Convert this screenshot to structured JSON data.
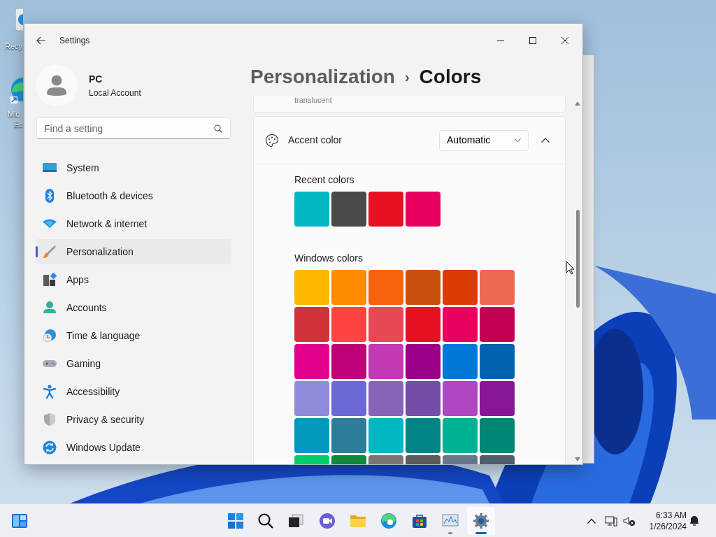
{
  "desktop_icons": [
    {
      "lines": [
        "Recy"
      ]
    },
    {
      "lines": [
        "Mic",
        "Ec"
      ]
    }
  ],
  "window": {
    "title": "Settings"
  },
  "profile": {
    "name": "PC",
    "account_type": "Local Account"
  },
  "search": {
    "placeholder": "Find a setting"
  },
  "nav": {
    "items": [
      {
        "label": "System",
        "selected": false
      },
      {
        "label": "Bluetooth & devices",
        "selected": false
      },
      {
        "label": "Network & internet",
        "selected": false
      },
      {
        "label": "Personalization",
        "selected": true
      },
      {
        "label": "Apps",
        "selected": false
      },
      {
        "label": "Accounts",
        "selected": false
      },
      {
        "label": "Time & language",
        "selected": false
      },
      {
        "label": "Gaming",
        "selected": false
      },
      {
        "label": "Accessibility",
        "selected": false
      },
      {
        "label": "Privacy & security",
        "selected": false
      },
      {
        "label": "Windows Update",
        "selected": false
      }
    ]
  },
  "breadcrumb": {
    "parent": "Personalization",
    "separator": "›",
    "current": "Colors"
  },
  "partial_card": {
    "text": "translucent"
  },
  "accent": {
    "label": "Accent color",
    "dropdown": "Automatic",
    "expanded": true,
    "recent": {
      "label": "Recent colors",
      "colors": [
        {
          "color": "#00b7c3"
        },
        {
          "color": "#4c4a48"
        },
        {
          "color": "#e81123"
        },
        {
          "color": "#ea005e"
        }
      ]
    },
    "windows": {
      "label": "Windows colors",
      "colors": [
        {
          "color": "#ffb900"
        },
        {
          "color": "#ff8c00"
        },
        {
          "color": "#f7630c"
        },
        {
          "color": "#ca5010"
        },
        {
          "color": "#da3b01"
        },
        {
          "color": "#ef6950"
        },
        {
          "color": "#d13438"
        },
        {
          "color": "#ff4343"
        },
        {
          "color": "#e74856"
        },
        {
          "color": "#e81123"
        },
        {
          "color": "#ea005e"
        },
        {
          "color": "#c30052"
        },
        {
          "color": "#e3008c"
        },
        {
          "color": "#bf0077"
        },
        {
          "color": "#c239b3"
        },
        {
          "color": "#9a0089"
        },
        {
          "color": "#0078d7"
        },
        {
          "color": "#0063b1"
        },
        {
          "color": "#8e8cd8"
        },
        {
          "color": "#6b69d6"
        },
        {
          "color": "#8764b8"
        },
        {
          "color": "#744da9"
        },
        {
          "color": "#b146c2"
        },
        {
          "color": "#881798"
        },
        {
          "color": "#0099bc"
        },
        {
          "color": "#2d7d9a"
        },
        {
          "color": "#00b7c3"
        },
        {
          "color": "#038387"
        },
        {
          "color": "#00b294"
        },
        {
          "color": "#018574"
        },
        {
          "color": "#00cc6a"
        },
        {
          "color": "#10893e"
        },
        {
          "color": "#7a7574"
        },
        {
          "color": "#5d5a58"
        },
        {
          "color": "#68768a"
        },
        {
          "color": "#515c6b"
        }
      ]
    }
  },
  "taskbar": {
    "apps": [
      {
        "running": false,
        "active": false
      },
      {
        "running": false,
        "active": false
      },
      {
        "running": false,
        "active": false
      },
      {
        "running": false,
        "active": false
      },
      {
        "running": false,
        "active": false
      },
      {
        "running": false,
        "active": false
      },
      {
        "running": false,
        "active": false
      },
      {
        "running": true,
        "active": false
      },
      {
        "running": true,
        "active": true
      }
    ]
  },
  "tray": {
    "time": "6:33 AM",
    "date": "1/26/2024"
  }
}
